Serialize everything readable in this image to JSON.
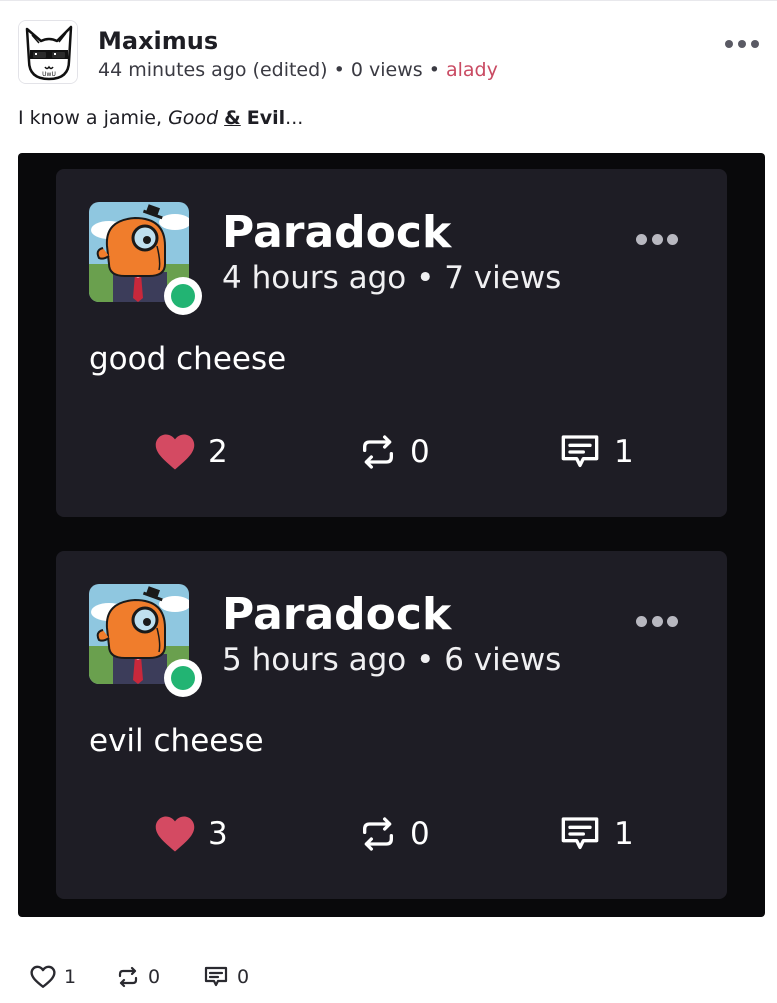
{
  "post": {
    "author": "Maximus",
    "time": "44 minutes ago (edited)",
    "views": "0 views",
    "tag": "alady",
    "body": {
      "prefix": "I know a jamie, ",
      "good": "Good",
      "space1": " ",
      "amp": "&",
      "space2": " ",
      "evil": "Evil",
      "suffix": "..."
    },
    "actions": {
      "likes": "1",
      "reposts": "0",
      "replies": "0"
    }
  },
  "embeds": [
    {
      "author": "Paradock",
      "meta": "4 hours ago • 7 views",
      "text": "good cheese",
      "likes": "2",
      "reposts": "0",
      "replies": "1"
    },
    {
      "author": "Paradock",
      "meta": "5 hours ago • 6 views",
      "text": "evil cheese",
      "likes": "3",
      "reposts": "0",
      "replies": "1"
    }
  ],
  "colors": {
    "like_filled": "#d44a62",
    "online": "#22b473",
    "tag": "#c94a62",
    "card_bg": "#1e1d25",
    "embed_bg": "#09090b"
  },
  "icons": {
    "avatar_main": "cat-with-sunglasses-avatar",
    "avatar_embed": "orange-monocle-duck-avatar",
    "menu": "more-dots-icon",
    "like": "heart-icon",
    "repost": "repost-icon",
    "reply": "comment-icon"
  }
}
